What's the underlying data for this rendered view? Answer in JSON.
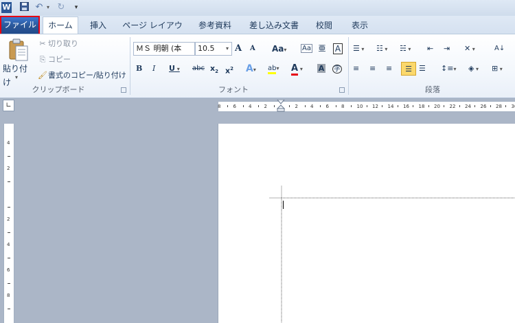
{
  "quick_access": {
    "app_icon": "word-icon",
    "save_icon": "save-icon",
    "undo_icon": "undo-icon",
    "redo_icon": "redo-icon",
    "customize_icon": "customize-qat-icon"
  },
  "tabs": [
    {
      "label": "ファイル"
    },
    {
      "label": "ホーム"
    },
    {
      "label": "挿入"
    },
    {
      "label": "ページ レイアウト"
    },
    {
      "label": "参考資料"
    },
    {
      "label": "差し込み文書"
    },
    {
      "label": "校閲"
    },
    {
      "label": "表示"
    }
  ],
  "clipboard": {
    "paste_label": "貼り付け",
    "cut_label": "切り取り",
    "copy_label": "コピー",
    "format_painter_label": "書式のコピー/貼り付け",
    "group_label": "クリップボード"
  },
  "font": {
    "font_name": "ＭＳ 明朝 (本",
    "font_size": "10.5",
    "grow_glyph": "A",
    "shrink_glyph": "A",
    "case_glyph": "Aa",
    "bold_glyph": "B",
    "italic_glyph": "I",
    "underline_glyph": "U",
    "strike_glyph": "abc",
    "subscript_glyph": "x",
    "superscript_glyph": "x",
    "enclose_glyph": "字",
    "group_label": "フォント"
  },
  "paragraph": {
    "group_label": "段落"
  },
  "ruler": {
    "h_labels": [
      "8",
      "6",
      "4",
      "2",
      "",
      "2",
      "4",
      "6",
      "8",
      "10",
      "12",
      "14",
      "16",
      "18",
      "20",
      "22",
      "24",
      "26",
      "28",
      "30"
    ],
    "v_labels": [
      "4",
      "2",
      "",
      "2",
      "4",
      "6",
      "8"
    ]
  },
  "colors": {
    "file_tab": "#2b5797",
    "highlight_box": "#e60012",
    "ribbon_bg": "#f3f7fc",
    "workspace_bg": "#abb6c7"
  }
}
